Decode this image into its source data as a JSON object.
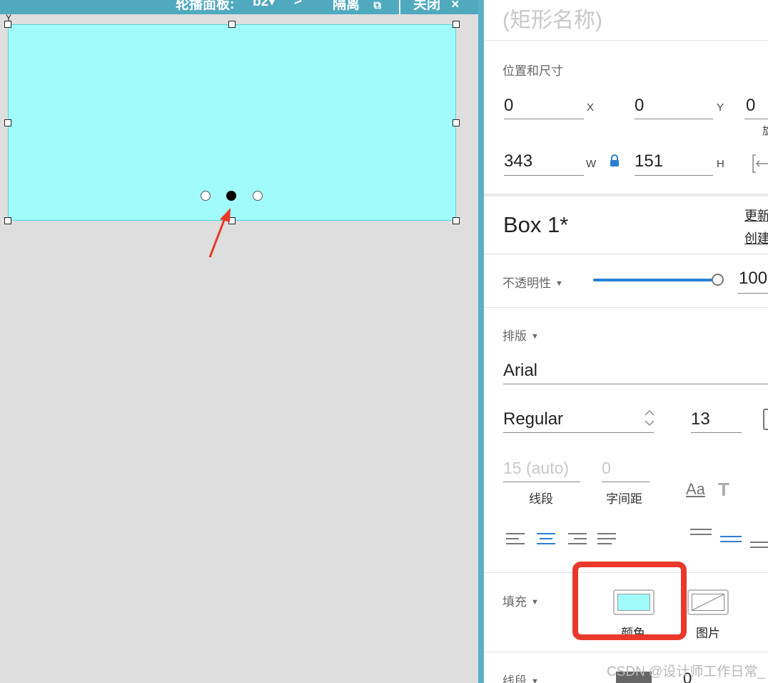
{
  "canvas": {
    "toolbar": {
      "panel_label": "轮播面板:",
      "state_name": "b2",
      "isolate_label": "隔离",
      "close_label": "关闭"
    },
    "rect_fill": "#a2fbfb",
    "pagination": {
      "count": 3,
      "active_index": 1
    },
    "annotation_color": "#e8392a"
  },
  "inspector": {
    "shape_name_placeholder": "(矩形名称)",
    "position_size": {
      "section_label": "位置和尺寸",
      "x": {
        "value": "0",
        "label": "X"
      },
      "y": {
        "value": "0",
        "label": "Y"
      },
      "rotation": {
        "value": "0",
        "label": "旋"
      },
      "w": {
        "value": "343",
        "label": "W"
      },
      "h": {
        "value": "151",
        "label": "H"
      }
    },
    "style": {
      "name": "Box 1*",
      "update_link": "更新",
      "create_link": "创建"
    },
    "opacity": {
      "label": "不透明性",
      "value": "100",
      "percent": 100
    },
    "typography": {
      "label": "排版",
      "font_family": "Arial",
      "font_weight": "Regular",
      "font_size": "13",
      "line_spacing": {
        "placeholder": "15 (auto)",
        "label": "线段"
      },
      "letter_spacing": {
        "placeholder": "0",
        "label": "字间距"
      },
      "case_icon_text": "Aa",
      "text_style_icon_text": "T",
      "alignment": [
        "left",
        "center",
        "right",
        "justify"
      ],
      "active_alignment": "center"
    },
    "fill": {
      "label": "填充",
      "color_option": "颜色",
      "image_option": "图片",
      "color": "#a2fbfb"
    },
    "border": {
      "label": "线段",
      "value": "0"
    }
  },
  "watermark": "CSDN @设计师工作日常_"
}
